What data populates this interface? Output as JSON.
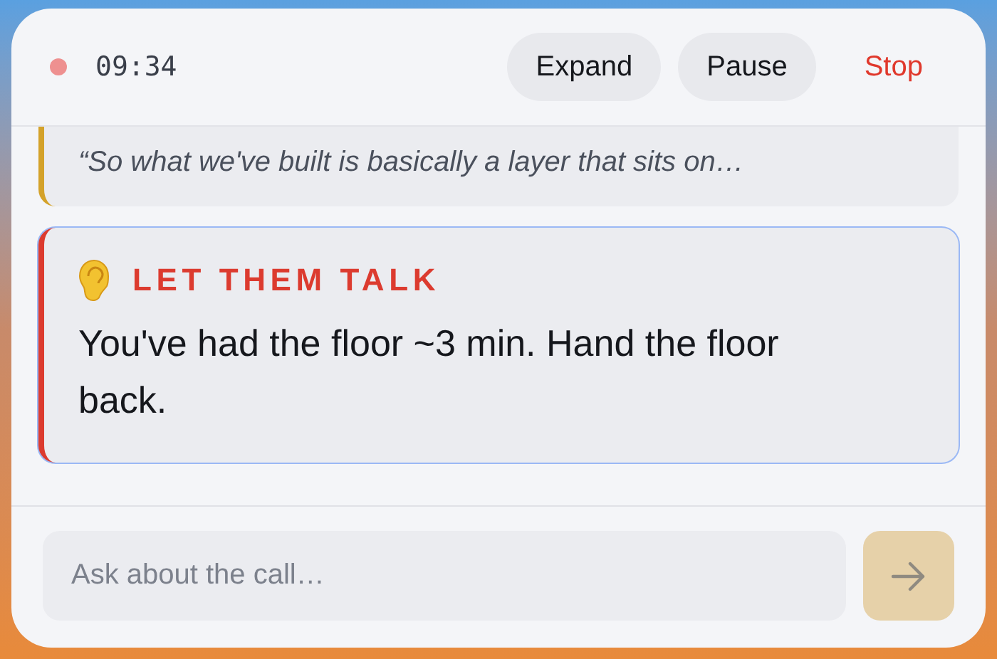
{
  "header": {
    "recording": true,
    "timer": "09:34",
    "buttons": [
      {
        "label": "Expand",
        "kind": "pill"
      },
      {
        "label": "Pause",
        "kind": "pill"
      },
      {
        "label": "Stop",
        "kind": "danger"
      }
    ]
  },
  "cards": [
    {
      "kind": "quote",
      "color": "#d4a22a",
      "text": "“So what we've built is basically a layer that sits on…",
      "selected": false
    },
    {
      "kind": "nudge",
      "color": "#dc3b2f",
      "title": "LET THEM TALK",
      "text": "You've had the floor ~3 min. Hand the floor back.",
      "selected": true
    }
  ],
  "composer": {
    "placeholder": "Ask about the call…",
    "send_disabled": true
  }
}
